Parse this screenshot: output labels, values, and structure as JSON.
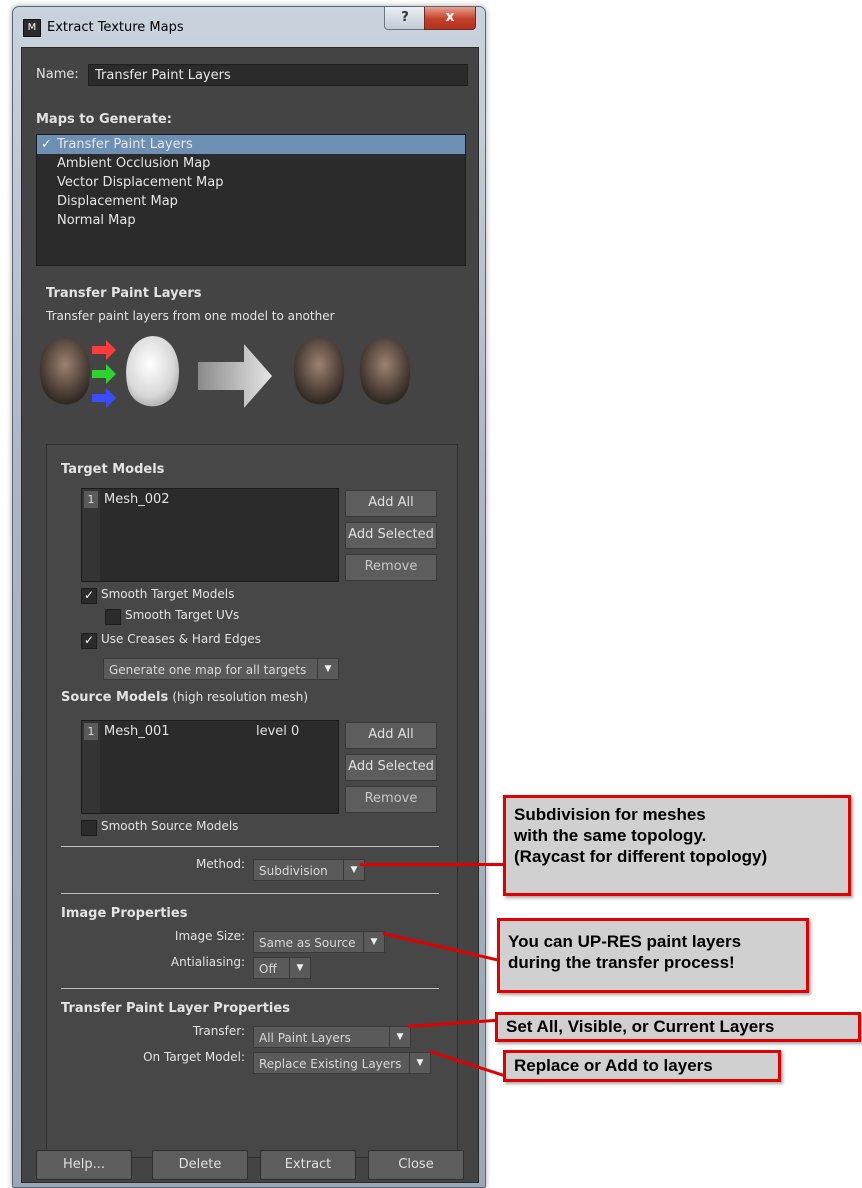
{
  "window": {
    "title": "Extract Texture Maps",
    "help_glyph": "?",
    "close_glyph": "x",
    "app_icon_glyph": "M"
  },
  "name": {
    "label": "Name:",
    "value": "Transfer Paint Layers"
  },
  "maps": {
    "heading": "Maps to Generate:",
    "items": [
      {
        "label": "Transfer Paint Layers",
        "checked": true,
        "selected": true
      },
      {
        "label": "Ambient Occlusion Map",
        "checked": false,
        "selected": false
      },
      {
        "label": "Vector Displacement Map",
        "checked": false,
        "selected": false
      },
      {
        "label": "Displacement Map",
        "checked": false,
        "selected": false
      },
      {
        "label": "Normal Map",
        "checked": false,
        "selected": false
      }
    ],
    "check_glyph": "✓"
  },
  "transfer_info": {
    "heading": "Transfer Paint Layers",
    "description": "Transfer paint layers from one model to another"
  },
  "target_models": {
    "heading": "Target Models",
    "rows": [
      {
        "index": "1",
        "name": "Mesh_002"
      }
    ],
    "add_all": "Add All",
    "add_selected": "Add Selected",
    "remove": "Remove",
    "smooth_target_models": "Smooth Target Models",
    "smooth_target_uvs": "Smooth Target UVs",
    "use_creases": "Use Creases & Hard Edges",
    "map_mode": "Generate one map for all targets"
  },
  "source_models": {
    "heading": "Source Models",
    "subheading": "(high resolution mesh)",
    "rows": [
      {
        "index": "1",
        "name": "Mesh_001",
        "level": "level 0"
      }
    ],
    "add_all": "Add All",
    "add_selected": "Add Selected",
    "remove": "Remove",
    "smooth_source_models": "Smooth Source Models"
  },
  "method": {
    "label": "Method:",
    "value": "Subdivision"
  },
  "image_properties": {
    "heading": "Image Properties",
    "size_label": "Image Size:",
    "size_value": "Same as Source",
    "aa_label": "Antialiasing:",
    "aa_value": "Off"
  },
  "paint_layer_props": {
    "heading": "Transfer Paint Layer Properties",
    "transfer_label": "Transfer:",
    "transfer_value": "All Paint Layers",
    "target_label": "On Target Model:",
    "target_value": "Replace Existing Layers"
  },
  "footer": {
    "help": "Help...",
    "delete": "Delete",
    "extract": "Extract",
    "close": "Close"
  },
  "dropdown_arrow": "▼",
  "callouts": {
    "method_note": [
      "Subdivision for meshes",
      "with the same topology.",
      "(Raycast for different topology)"
    ],
    "size_note": [
      "You can UP-RES paint layers",
      "during the transfer process!"
    ],
    "transfer_note": "Set All, Visible, or Current Layers",
    "target_note": "Replace or Add to layers"
  },
  "colors": {
    "callout_border": "#e00000",
    "selection": "#6d8fb3",
    "panel_bg": "#444444"
  }
}
